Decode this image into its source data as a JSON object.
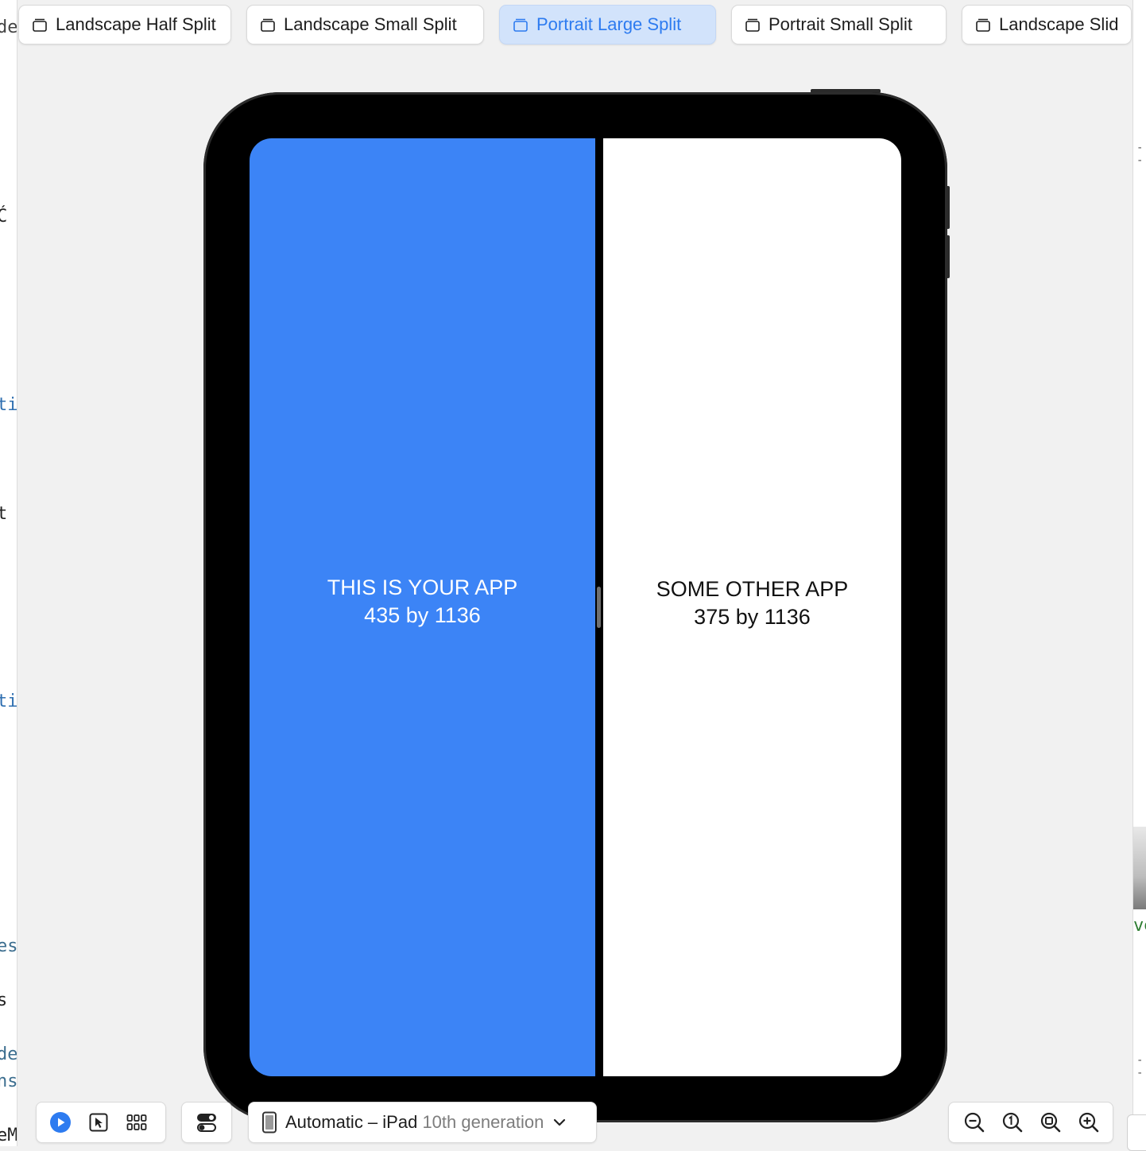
{
  "editor_fragments": [
    "de",
    "Ć",
    "ti",
    "t",
    "ti",
    "es",
    "s",
    "de",
    "ns",
    "eM"
  ],
  "right_fragment": "ve",
  "presets": [
    {
      "label": "Landscape Half Split",
      "selected": false
    },
    {
      "label": "Landscape Small Split",
      "selected": false
    },
    {
      "label": "Portrait Large Split",
      "selected": true
    },
    {
      "label": "Portrait Small Split",
      "selected": false
    },
    {
      "label": "Landscape Slid",
      "selected": false
    }
  ],
  "preview": {
    "your_app": {
      "title": "THIS IS YOUR APP",
      "size": "435 by 1136",
      "color": "#3c84f6"
    },
    "other_app": {
      "title": "SOME OTHER APP",
      "size": "375 by 1136",
      "color": "#ffffff"
    }
  },
  "toolbar": {
    "mode_icons": [
      "play-circle-icon",
      "cursor-select-icon",
      "grid-variants-icon"
    ],
    "settings_icon": "toggle-settings-icon",
    "device": {
      "prefix": "Automatic – iPad",
      "suffix": "10th generation"
    },
    "zoom_icons": [
      "zoom-out-icon",
      "zoom-actual-icon",
      "zoom-fit-icon",
      "zoom-in-icon"
    ]
  },
  "colors": {
    "accent": "#2d7bf0",
    "selected_pill": "#d2e3fb",
    "canvas": "#f1f1f1"
  }
}
